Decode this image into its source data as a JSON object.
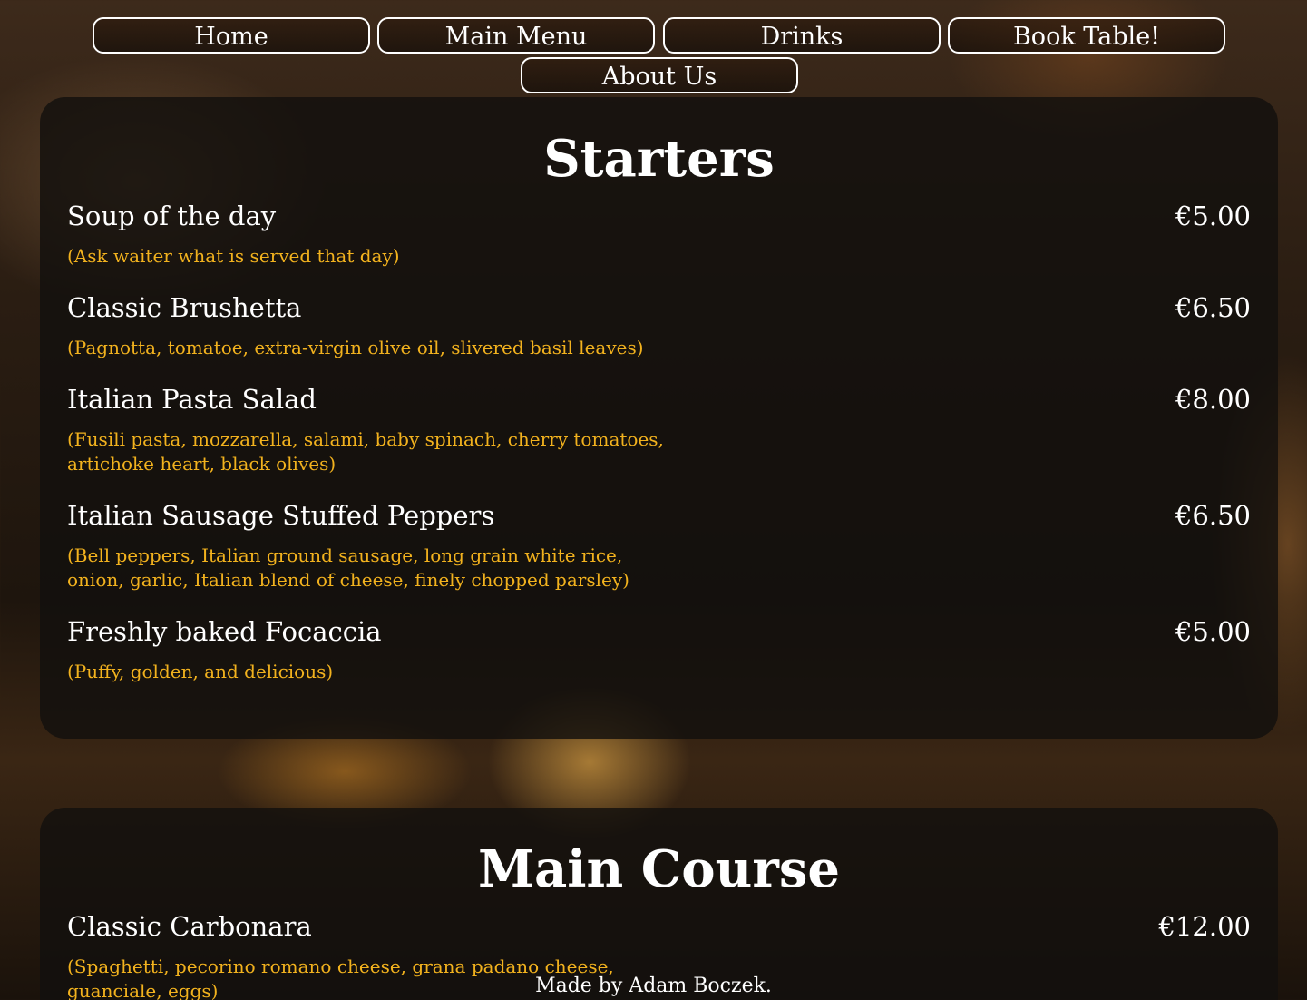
{
  "nav": {
    "items": [
      {
        "label": "Home"
      },
      {
        "label": "Main Menu"
      },
      {
        "label": "Drinks"
      },
      {
        "label": "Book Table!"
      },
      {
        "label": "About Us"
      }
    ]
  },
  "starters": {
    "title": "Starters",
    "items": [
      {
        "name": "Soup of the day",
        "price": "€5.00",
        "desc": "(Ask waiter what is served that day)"
      },
      {
        "name": "Classic Brushetta",
        "price": "€6.50",
        "desc": "(Pagnotta, tomatoe, extra-virgin olive oil, slivered basil leaves)"
      },
      {
        "name": "Italian Pasta Salad",
        "price": "€8.00",
        "desc": "(Fusili pasta, mozzarella, salami, baby spinach, cherry tomatoes, artichoke heart, black olives)"
      },
      {
        "name": "Italian Sausage Stuffed Peppers",
        "price": "€6.50",
        "desc": "(Bell peppers, Italian ground sausage, long grain white rice, onion, garlic, Italian blend of cheese, finely chopped parsley)"
      },
      {
        "name": "Freshly baked Focaccia",
        "price": "€5.00",
        "desc": "(Puffy, golden, and delicious)"
      }
    ]
  },
  "main_course": {
    "title": "Main Course",
    "items": [
      {
        "name": "Classic Carbonara",
        "price": "€12.00",
        "desc": "(Spaghetti, pecorino romano cheese, grana padano cheese, guanciale, eggs)"
      }
    ]
  },
  "footer": {
    "text": "Made by Adam Boczek."
  },
  "colors": {
    "accent_desc": "#f2b21e",
    "text": "#ffffff",
    "card_bg": "#12100e"
  }
}
